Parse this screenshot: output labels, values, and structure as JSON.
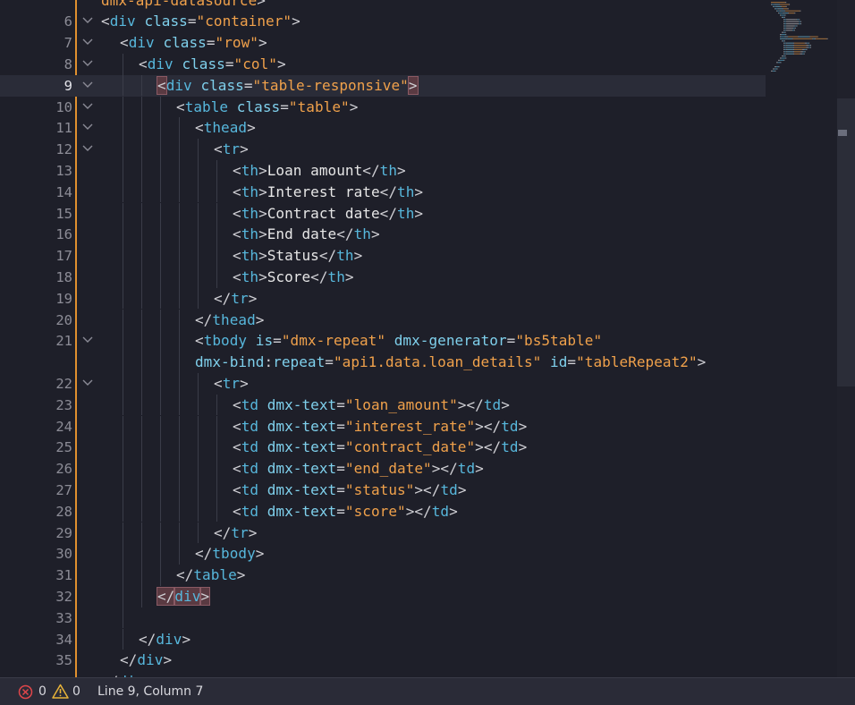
{
  "editor": {
    "current_line": 9,
    "lines": [
      {
        "num": "",
        "indent": 0,
        "fold": false,
        "tokens": [
          [
            "t-val",
            "dmx-api-datasource"
          ],
          [
            "t-punct",
            ">"
          ]
        ],
        "partial": true
      },
      {
        "num": "6",
        "indent": 0,
        "fold": true,
        "tokens": [
          [
            "t-punct",
            "<"
          ],
          [
            "t-tag",
            "div"
          ],
          [
            "t-punct",
            " "
          ],
          [
            "t-attr",
            "class"
          ],
          [
            "t-punct",
            "="
          ],
          [
            "t-val",
            "\"container\""
          ],
          [
            "t-punct",
            ">"
          ]
        ]
      },
      {
        "num": "7",
        "indent": 1,
        "fold": true,
        "tokens": [
          [
            "t-punct",
            "<"
          ],
          [
            "t-tag",
            "div"
          ],
          [
            "t-punct",
            " "
          ],
          [
            "t-attr",
            "class"
          ],
          [
            "t-punct",
            "="
          ],
          [
            "t-val",
            "\"row\""
          ],
          [
            "t-punct",
            ">"
          ]
        ]
      },
      {
        "num": "8",
        "indent": 2,
        "fold": true,
        "tokens": [
          [
            "t-punct",
            "<"
          ],
          [
            "t-tag",
            "div"
          ],
          [
            "t-punct",
            " "
          ],
          [
            "t-attr",
            "class"
          ],
          [
            "t-punct",
            "="
          ],
          [
            "t-val",
            "\"col\""
          ],
          [
            "t-punct",
            ">"
          ]
        ]
      },
      {
        "num": "9",
        "indent": 3,
        "fold": true,
        "current": true,
        "tokens": [
          [
            "match",
            "<"
          ],
          [
            "t-tag",
            "div"
          ],
          [
            "t-punct",
            " "
          ],
          [
            "t-attr",
            "class"
          ],
          [
            "t-punct",
            "="
          ],
          [
            "t-val",
            "\"table-responsive\""
          ],
          [
            "match",
            ">"
          ]
        ]
      },
      {
        "num": "10",
        "indent": 4,
        "fold": true,
        "tokens": [
          [
            "t-punct",
            "<"
          ],
          [
            "t-tag",
            "table"
          ],
          [
            "t-punct",
            " "
          ],
          [
            "t-attr",
            "class"
          ],
          [
            "t-punct",
            "="
          ],
          [
            "t-val",
            "\"table\""
          ],
          [
            "t-punct",
            ">"
          ]
        ]
      },
      {
        "num": "11",
        "indent": 5,
        "fold": true,
        "tokens": [
          [
            "t-punct",
            "<"
          ],
          [
            "t-tag",
            "thead"
          ],
          [
            "t-punct",
            ">"
          ]
        ]
      },
      {
        "num": "12",
        "indent": 6,
        "fold": true,
        "tokens": [
          [
            "t-punct",
            "<"
          ],
          [
            "t-tag",
            "tr"
          ],
          [
            "t-punct",
            ">"
          ]
        ]
      },
      {
        "num": "13",
        "indent": 7,
        "fold": false,
        "tokens": [
          [
            "t-punct",
            "<"
          ],
          [
            "t-tag",
            "th"
          ],
          [
            "t-punct",
            ">"
          ],
          [
            "t-text",
            "Loan amount"
          ],
          [
            "t-punct",
            "</"
          ],
          [
            "t-tag",
            "th"
          ],
          [
            "t-punct",
            ">"
          ]
        ]
      },
      {
        "num": "14",
        "indent": 7,
        "fold": false,
        "tokens": [
          [
            "t-punct",
            "<"
          ],
          [
            "t-tag",
            "th"
          ],
          [
            "t-punct",
            ">"
          ],
          [
            "t-text",
            "Interest rate"
          ],
          [
            "t-punct",
            "</"
          ],
          [
            "t-tag",
            "th"
          ],
          [
            "t-punct",
            ">"
          ]
        ]
      },
      {
        "num": "15",
        "indent": 7,
        "fold": false,
        "tokens": [
          [
            "t-punct",
            "<"
          ],
          [
            "t-tag",
            "th"
          ],
          [
            "t-punct",
            ">"
          ],
          [
            "t-text",
            "Contract date"
          ],
          [
            "t-punct",
            "</"
          ],
          [
            "t-tag",
            "th"
          ],
          [
            "t-punct",
            ">"
          ]
        ]
      },
      {
        "num": "16",
        "indent": 7,
        "fold": false,
        "tokens": [
          [
            "t-punct",
            "<"
          ],
          [
            "t-tag",
            "th"
          ],
          [
            "t-punct",
            ">"
          ],
          [
            "t-text",
            "End date"
          ],
          [
            "t-punct",
            "</"
          ],
          [
            "t-tag",
            "th"
          ],
          [
            "t-punct",
            ">"
          ]
        ]
      },
      {
        "num": "17",
        "indent": 7,
        "fold": false,
        "tokens": [
          [
            "t-punct",
            "<"
          ],
          [
            "t-tag",
            "th"
          ],
          [
            "t-punct",
            ">"
          ],
          [
            "t-text",
            "Status"
          ],
          [
            "t-punct",
            "</"
          ],
          [
            "t-tag",
            "th"
          ],
          [
            "t-punct",
            ">"
          ]
        ]
      },
      {
        "num": "18",
        "indent": 7,
        "fold": false,
        "tokens": [
          [
            "t-punct",
            "<"
          ],
          [
            "t-tag",
            "th"
          ],
          [
            "t-punct",
            ">"
          ],
          [
            "t-text",
            "Score"
          ],
          [
            "t-punct",
            "</"
          ],
          [
            "t-tag",
            "th"
          ],
          [
            "t-punct",
            ">"
          ]
        ]
      },
      {
        "num": "19",
        "indent": 6,
        "fold": false,
        "tokens": [
          [
            "t-punct",
            "</"
          ],
          [
            "t-tag",
            "tr"
          ],
          [
            "t-punct",
            ">"
          ]
        ]
      },
      {
        "num": "20",
        "indent": 5,
        "fold": false,
        "tokens": [
          [
            "t-punct",
            "</"
          ],
          [
            "t-tag",
            "thead"
          ],
          [
            "t-punct",
            ">"
          ]
        ]
      },
      {
        "num": "21",
        "indent": 5,
        "fold": true,
        "tokens": [
          [
            "t-punct",
            "<"
          ],
          [
            "t-tag",
            "tbody"
          ],
          [
            "t-punct",
            " "
          ],
          [
            "t-attr",
            "is"
          ],
          [
            "t-punct",
            "="
          ],
          [
            "t-val",
            "\"dmx-repeat\""
          ],
          [
            "t-punct",
            " "
          ],
          [
            "t-attr",
            "dmx-generator"
          ],
          [
            "t-punct",
            "="
          ],
          [
            "t-val",
            "\"bs5table\""
          ]
        ]
      },
      {
        "num": "",
        "indent": 5,
        "fold": false,
        "wrap": true,
        "tokens": [
          [
            "t-attr",
            "dmx-bind"
          ],
          [
            "t-punct",
            ":"
          ],
          [
            "t-attr",
            "repeat"
          ],
          [
            "t-punct",
            "="
          ],
          [
            "t-val",
            "\"api1.data.loan_details\""
          ],
          [
            "t-punct",
            " "
          ],
          [
            "t-attr",
            "id"
          ],
          [
            "t-punct",
            "="
          ],
          [
            "t-val",
            "\"tableRepeat2\""
          ],
          [
            "t-punct",
            ">"
          ]
        ]
      },
      {
        "num": "22",
        "indent": 6,
        "fold": true,
        "tokens": [
          [
            "t-punct",
            "<"
          ],
          [
            "t-tag",
            "tr"
          ],
          [
            "t-punct",
            ">"
          ]
        ]
      },
      {
        "num": "23",
        "indent": 7,
        "fold": false,
        "tokens": [
          [
            "t-punct",
            "<"
          ],
          [
            "t-tag",
            "td"
          ],
          [
            "t-punct",
            " "
          ],
          [
            "t-attr",
            "dmx-text"
          ],
          [
            "t-punct",
            "="
          ],
          [
            "t-val",
            "\"loan_amount\""
          ],
          [
            "t-punct",
            "></"
          ],
          [
            "t-tag",
            "td"
          ],
          [
            "t-punct",
            ">"
          ]
        ]
      },
      {
        "num": "24",
        "indent": 7,
        "fold": false,
        "tokens": [
          [
            "t-punct",
            "<"
          ],
          [
            "t-tag",
            "td"
          ],
          [
            "t-punct",
            " "
          ],
          [
            "t-attr",
            "dmx-text"
          ],
          [
            "t-punct",
            "="
          ],
          [
            "t-val",
            "\"interest_rate\""
          ],
          [
            "t-punct",
            "></"
          ],
          [
            "t-tag",
            "td"
          ],
          [
            "t-punct",
            ">"
          ]
        ]
      },
      {
        "num": "25",
        "indent": 7,
        "fold": false,
        "tokens": [
          [
            "t-punct",
            "<"
          ],
          [
            "t-tag",
            "td"
          ],
          [
            "t-punct",
            " "
          ],
          [
            "t-attr",
            "dmx-text"
          ],
          [
            "t-punct",
            "="
          ],
          [
            "t-val",
            "\"contract_date\""
          ],
          [
            "t-punct",
            "></"
          ],
          [
            "t-tag",
            "td"
          ],
          [
            "t-punct",
            ">"
          ]
        ]
      },
      {
        "num": "26",
        "indent": 7,
        "fold": false,
        "tokens": [
          [
            "t-punct",
            "<"
          ],
          [
            "t-tag",
            "td"
          ],
          [
            "t-punct",
            " "
          ],
          [
            "t-attr",
            "dmx-text"
          ],
          [
            "t-punct",
            "="
          ],
          [
            "t-val",
            "\"end_date\""
          ],
          [
            "t-punct",
            "></"
          ],
          [
            "t-tag",
            "td"
          ],
          [
            "t-punct",
            ">"
          ]
        ]
      },
      {
        "num": "27",
        "indent": 7,
        "fold": false,
        "tokens": [
          [
            "t-punct",
            "<"
          ],
          [
            "t-tag",
            "td"
          ],
          [
            "t-punct",
            " "
          ],
          [
            "t-attr",
            "dmx-text"
          ],
          [
            "t-punct",
            "="
          ],
          [
            "t-val",
            "\"status\""
          ],
          [
            "t-punct",
            "></"
          ],
          [
            "t-tag",
            "td"
          ],
          [
            "t-punct",
            ">"
          ]
        ]
      },
      {
        "num": "28",
        "indent": 7,
        "fold": false,
        "tokens": [
          [
            "t-punct",
            "<"
          ],
          [
            "t-tag",
            "td"
          ],
          [
            "t-punct",
            " "
          ],
          [
            "t-attr",
            "dmx-text"
          ],
          [
            "t-punct",
            "="
          ],
          [
            "t-val",
            "\"score\""
          ],
          [
            "t-punct",
            "></"
          ],
          [
            "t-tag",
            "td"
          ],
          [
            "t-punct",
            ">"
          ]
        ]
      },
      {
        "num": "29",
        "indent": 6,
        "fold": false,
        "tokens": [
          [
            "t-punct",
            "</"
          ],
          [
            "t-tag",
            "tr"
          ],
          [
            "t-punct",
            ">"
          ]
        ]
      },
      {
        "num": "30",
        "indent": 5,
        "fold": false,
        "tokens": [
          [
            "t-punct",
            "</"
          ],
          [
            "t-tag",
            "tbody"
          ],
          [
            "t-punct",
            ">"
          ]
        ]
      },
      {
        "num": "31",
        "indent": 4,
        "fold": false,
        "tokens": [
          [
            "t-punct",
            "</"
          ],
          [
            "t-tag",
            "table"
          ],
          [
            "t-punct",
            ">"
          ]
        ]
      },
      {
        "num": "32",
        "indent": 3,
        "fold": false,
        "tokens": [
          [
            "match",
            "</"
          ],
          [
            "match-tag",
            "div"
          ],
          [
            "match",
            ">"
          ]
        ]
      },
      {
        "num": "33",
        "indent": 2,
        "fold": false,
        "tokens": []
      },
      {
        "num": "34",
        "indent": 2,
        "fold": false,
        "tokens": [
          [
            "t-punct",
            "</"
          ],
          [
            "t-tag",
            "div"
          ],
          [
            "t-punct",
            ">"
          ]
        ]
      },
      {
        "num": "35",
        "indent": 1,
        "fold": false,
        "tokens": [
          [
            "t-punct",
            "</"
          ],
          [
            "t-tag",
            "div"
          ],
          [
            "t-punct",
            ">"
          ]
        ]
      },
      {
        "num": "",
        "indent": 0,
        "fold": false,
        "partial": true,
        "tokens": [
          [
            "t-punct",
            "</"
          ],
          [
            "t-tag",
            "div"
          ],
          [
            "t-punct",
            ">"
          ]
        ]
      }
    ]
  },
  "status_bar": {
    "errors": "0",
    "warnings": "0",
    "cursor": "Line 9, Column 7",
    "error_color": "#e0464a",
    "warning_color": "#e8b339"
  }
}
